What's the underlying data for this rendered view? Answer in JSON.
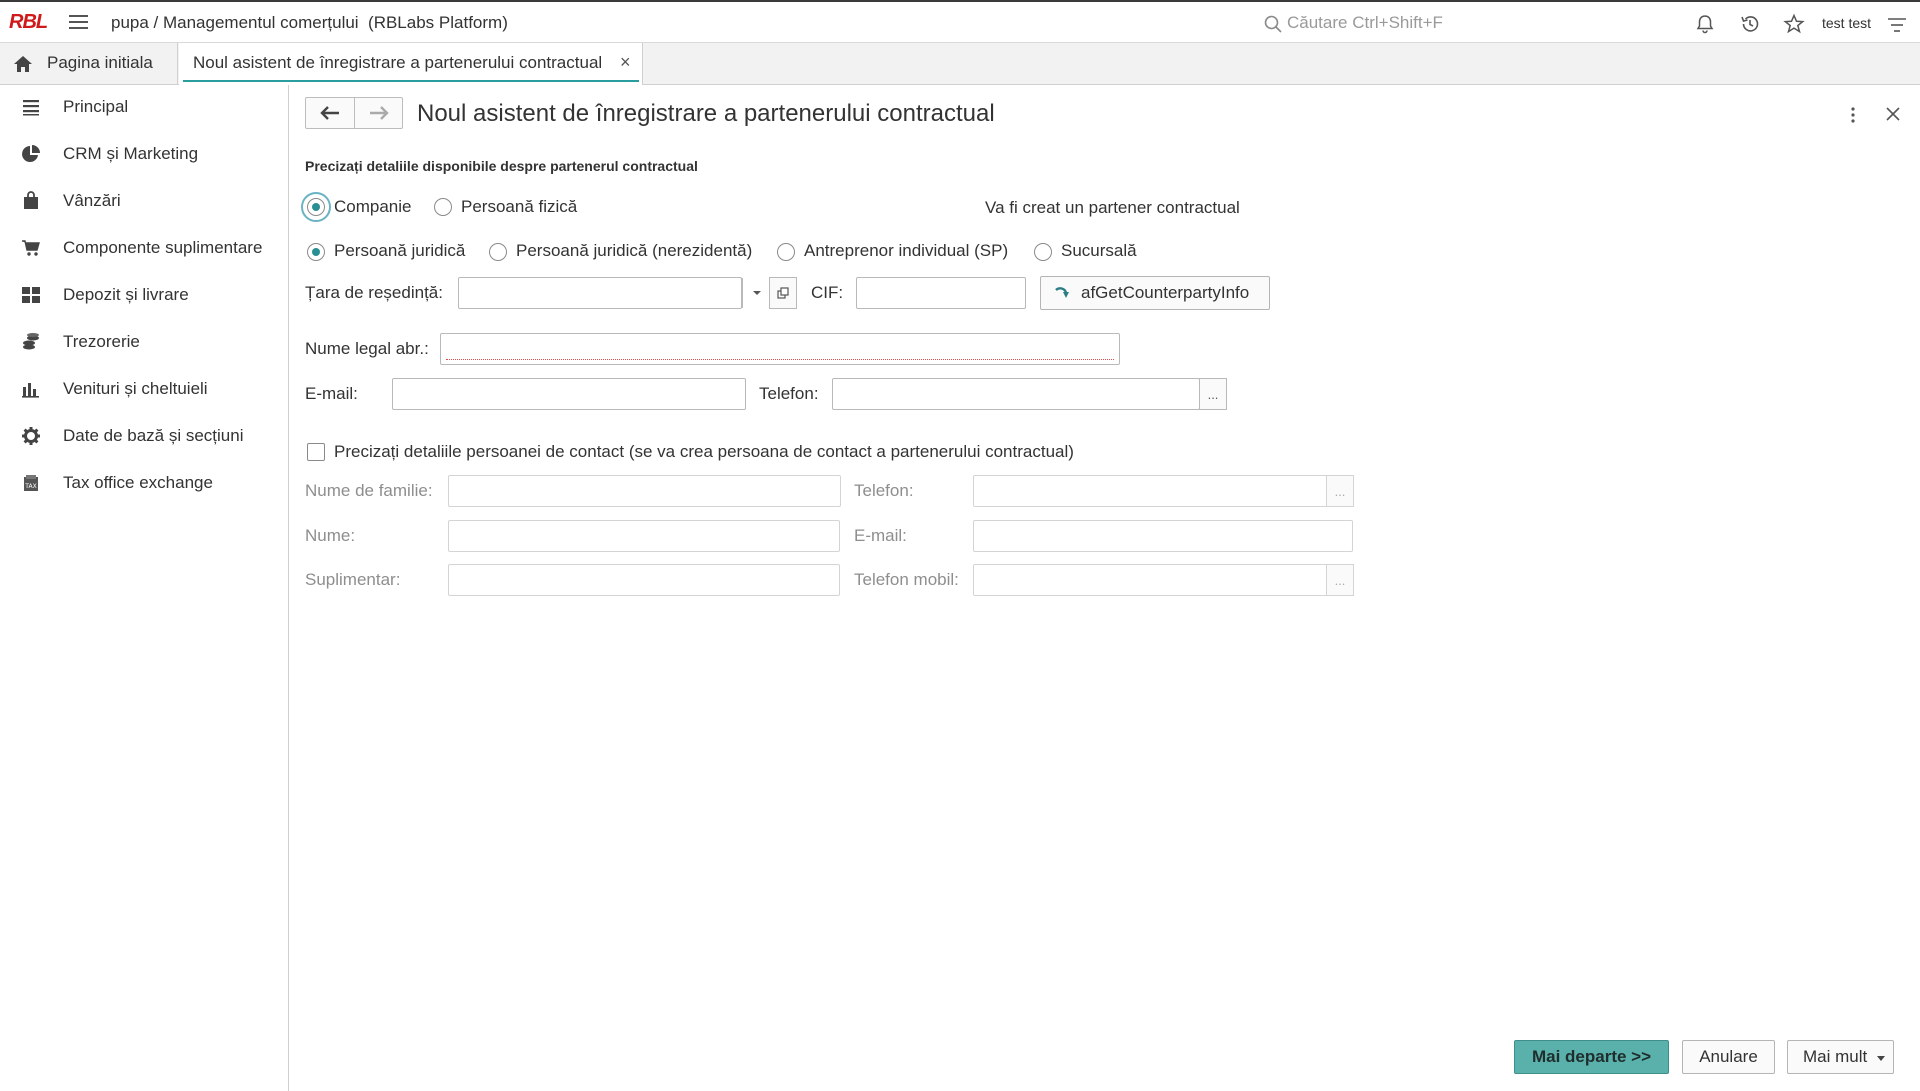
{
  "topbar": {
    "logo": "RBL",
    "title": "pupa / Managementul comerțului  (RBLabs Platform)",
    "search_placeholder": "Căutare Ctrl+Shift+F",
    "username": "test test"
  },
  "tabs": {
    "home_label": "Pagina initiala",
    "active_label": "Noul asistent de înregistrare a partenerului contractual"
  },
  "sidebar": {
    "items": [
      {
        "label": "Principal",
        "icon": "menu-lines-icon"
      },
      {
        "label": "CRM și Marketing",
        "icon": "pie-chart-icon"
      },
      {
        "label": "Vânzări",
        "icon": "shopping-bag-icon"
      },
      {
        "label": "Componente suplimentare",
        "icon": "cart-icon"
      },
      {
        "label": "Depozit și livrare",
        "icon": "grid-blocks-icon"
      },
      {
        "label": "Trezorerie",
        "icon": "coins-icon"
      },
      {
        "label": "Venituri și cheltuieli",
        "icon": "bar-chart-icon"
      },
      {
        "label": "Date de bază și secțiuni",
        "icon": "gear-icon"
      },
      {
        "label": "Tax office exchange",
        "icon": "tax-document-icon"
      }
    ]
  },
  "form": {
    "title": "Noul asistent de înregistrare a partenerului contractual",
    "section_header": "Precizați detaliile disponibile despre partenerul contractual",
    "entity_type": {
      "options": [
        "Companie",
        "Persoană fizică"
      ],
      "selected": "Companie",
      "info": "Va fi creat un partener contractual"
    },
    "legal_form": {
      "options": [
        "Persoană juridică",
        "Persoană juridică (nerezidentă)",
        "Antreprenor individual (SP)",
        "Sucursală"
      ],
      "selected": "Persoană juridică"
    },
    "country_label": "Țara de reședință:",
    "country_value": "",
    "cif_label": "CIF:",
    "cif_value": "",
    "fetch_button": "afGetCounterpartyInfo",
    "legal_name_label": "Nume legal abr.:",
    "legal_name_value": "",
    "email_label": "E-mail:",
    "email_value": "",
    "phone_label": "Telefon:",
    "phone_value": "",
    "contact_checkbox_label": "Precizați detaliile persoanei de contact (se va crea persoana de contact a partenerului contractual)",
    "contact_checked": false,
    "contact": {
      "last_name_label": "Nume de familie:",
      "phone_label": "Telefon:",
      "first_name_label": "Nume:",
      "email_label": "E-mail:",
      "additional_label": "Suplimentar:",
      "mobile_label": "Telefon mobil:"
    }
  },
  "footer": {
    "next_button": "Mai departe >>",
    "cancel_button": "Anulare",
    "more_button": "Mai mult"
  },
  "colors": {
    "accent": "#2a9d9e",
    "primary_button": "#5ab1ab",
    "logo": "#d0191a"
  }
}
